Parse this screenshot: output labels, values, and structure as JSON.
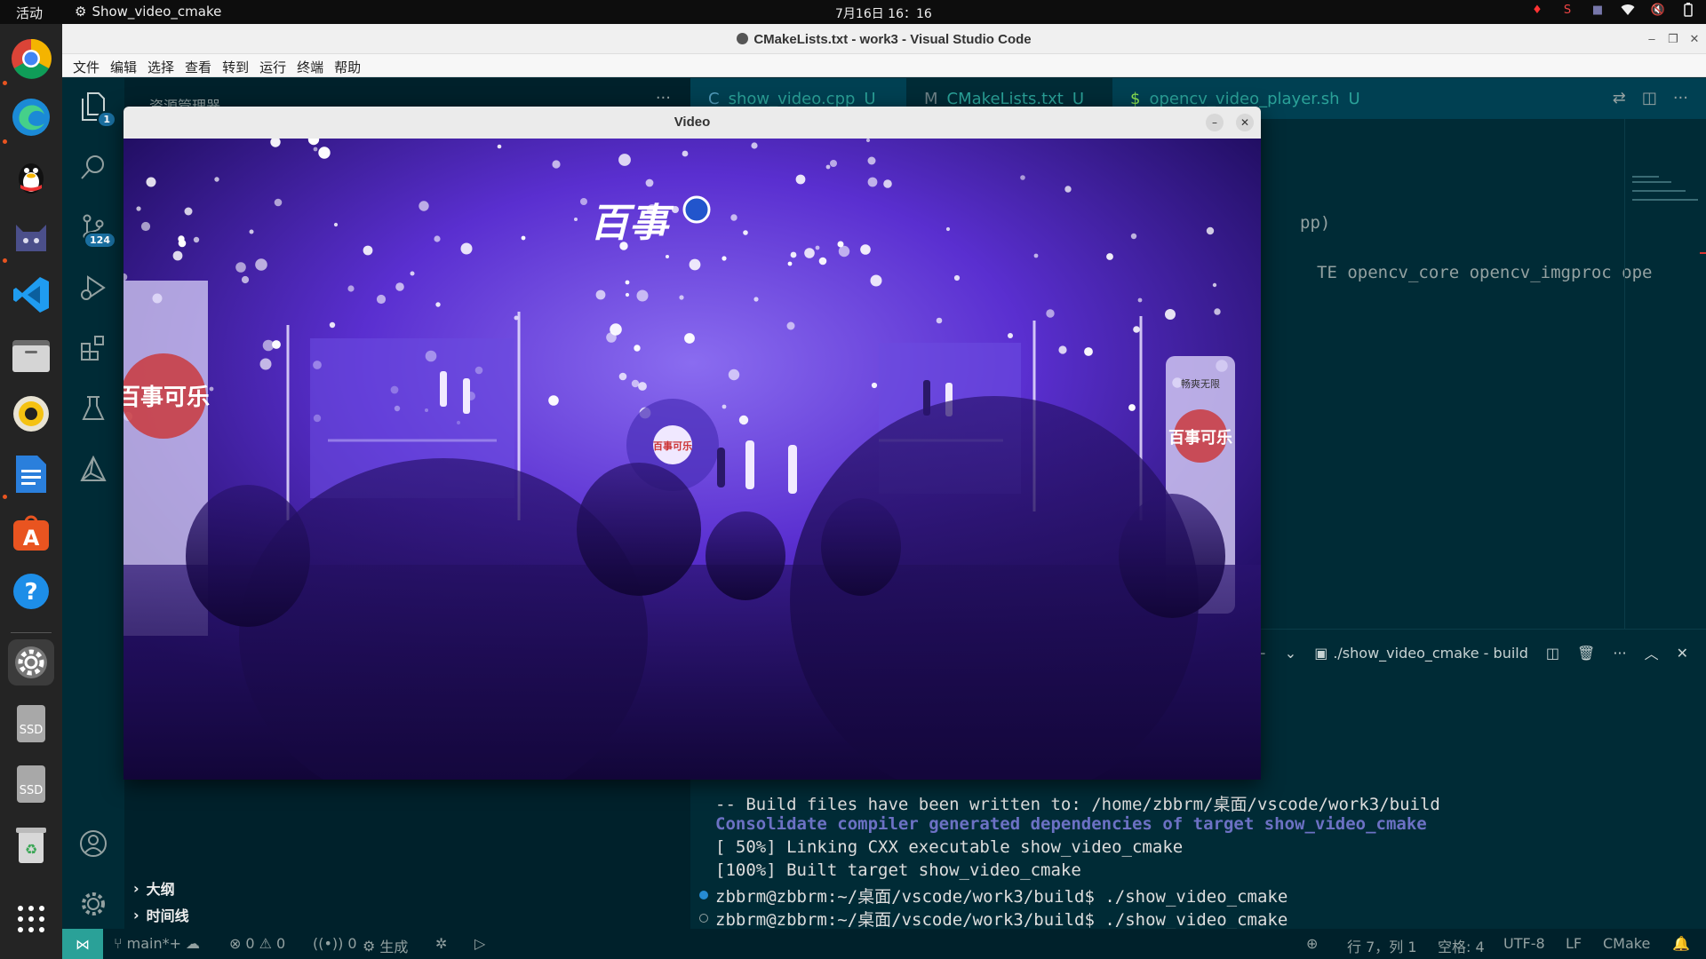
{
  "topbar": {
    "activities": "活动",
    "app_name": "Show_video_cmake",
    "clock": "7月16日  16：16"
  },
  "dock": {
    "items": [
      "Google Chrome",
      "Microsoft Edge",
      "QQ",
      "Sticker",
      "Visual Studio Code",
      "Files",
      "Rhythmbox",
      "LibreOffice Writer",
      "Ubuntu Software",
      "Help",
      "Settings",
      "SSD",
      "SSD",
      "Trash",
      "Show Applications"
    ],
    "ssd_label": "SSD"
  },
  "window": {
    "title": "CMakeLists.txt - work3 - Visual Studio Code"
  },
  "menu": [
    "文件",
    "编辑",
    "选择",
    "查看",
    "转到",
    "运行",
    "终端",
    "帮助"
  ],
  "activity_bar": {
    "explorer_badge": "1",
    "scm_badge": "124"
  },
  "sidebar": {
    "header": "资源管理器",
    "outline": "大纲",
    "timeline": "时间线"
  },
  "tabs": [
    {
      "name": "show_video.cpp",
      "status": "U"
    },
    {
      "name": "CMakeLists.txt",
      "status": "U"
    },
    {
      "name": "opencv_video_player.sh",
      "status": "U"
    }
  ],
  "editor": {
    "line1": "pp)",
    "line2": "TE opencv_core opencv_imgproc ope"
  },
  "terminal": {
    "title": "./show_video_cmake - build",
    "lines": [
      "-- Build files have been written to: /home/zbbrm/桌面/vscode/work3/build",
      "Consolidate compiler generated dependencies of target show_video_cmake",
      "[ 50%] Linking CXX executable show_video_cmake",
      "[100%] Built target show_video_cmake",
      "zbbrm@zbbrm:~/桌面/vscode/work3/build$ ./show_video_cmake",
      "zbbrm@zbbrm:~/桌面/vscode/work3/build$ ./show_video_cmake"
    ]
  },
  "statusbar": {
    "branch": "main*+",
    "errors": "0",
    "warnings": "0",
    "ports": "0",
    "build": "生成",
    "position": "行 7，列 1",
    "spaces": "空格: 4",
    "encoding": "UTF-8",
    "eol": "LF",
    "language": "CMake"
  },
  "video": {
    "title": "Video",
    "stage_banner": "百事可乐",
    "banner_logo_text": "百事",
    "screen_text": "百事可乐",
    "tower_label": "畅爽无限"
  },
  "colors": {
    "vscode_bg": "#002b36",
    "accent_teal": "#2aa198",
    "terminal_bold": "#6c71c4",
    "stage_purple": "#5a2fd0"
  }
}
